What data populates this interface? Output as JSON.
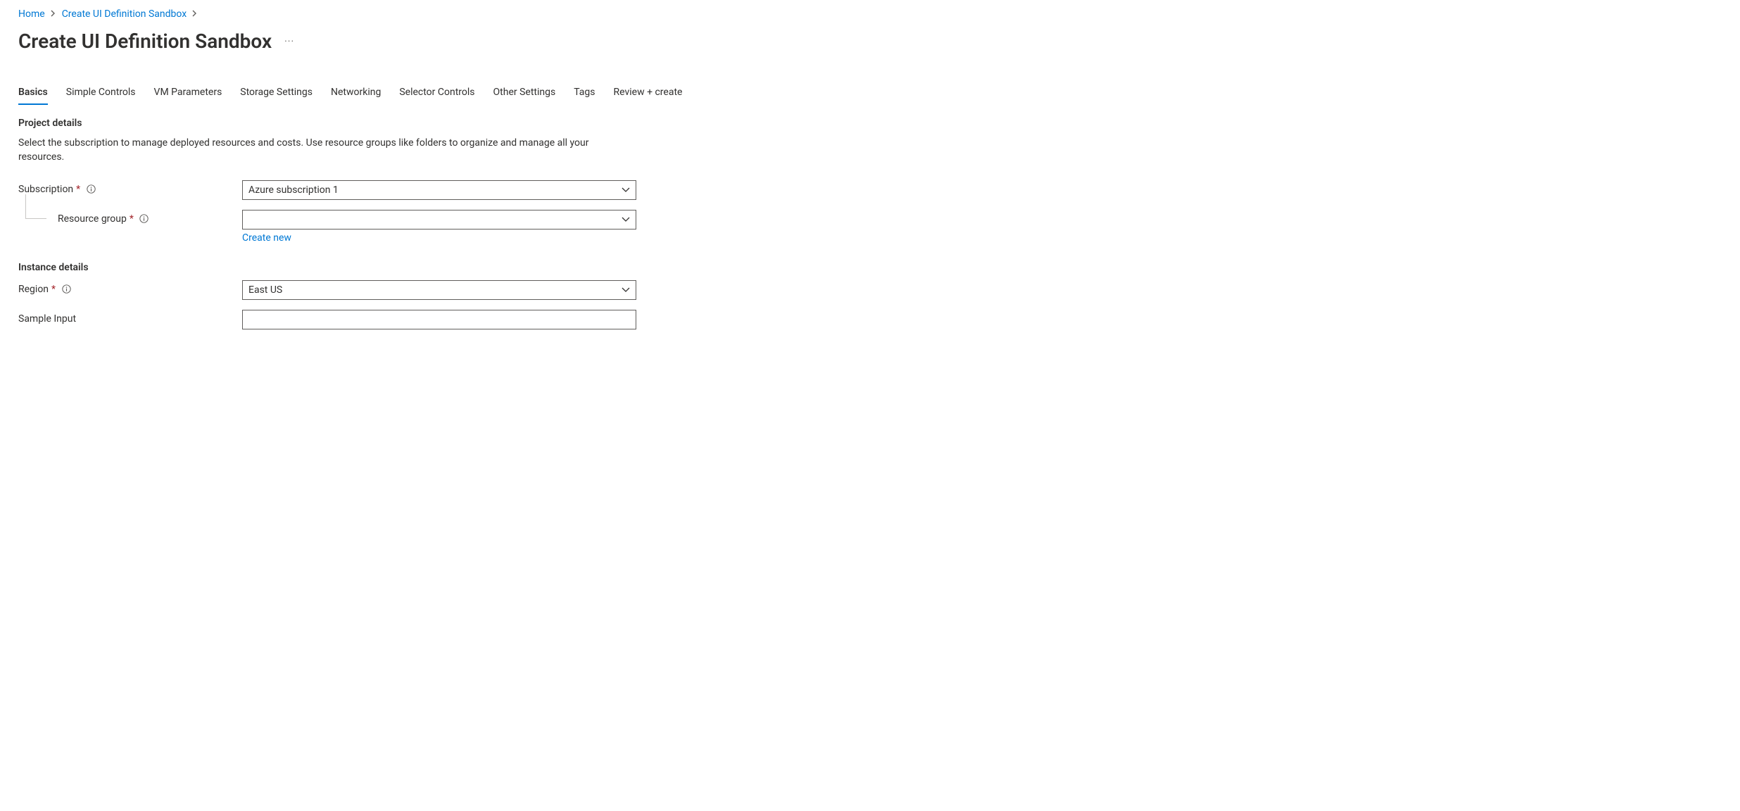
{
  "breadcrumb": {
    "home": "Home",
    "item1": "Create UI Definition Sandbox"
  },
  "page_title": "Create UI Definition Sandbox",
  "tabs": [
    "Basics",
    "Simple Controls",
    "VM Parameters",
    "Storage Settings",
    "Networking",
    "Selector Controls",
    "Other Settings",
    "Tags",
    "Review + create"
  ],
  "active_tab_index": 0,
  "project_details": {
    "heading": "Project details",
    "desc": "Select the subscription to manage deployed resources and costs. Use resource groups like folders to organize and manage all your resources.",
    "subscription": {
      "label": "Subscription",
      "value": "Azure subscription 1"
    },
    "resource_group": {
      "label": "Resource group",
      "value": "",
      "create_new": "Create new"
    }
  },
  "instance_details": {
    "heading": "Instance details",
    "region": {
      "label": "Region",
      "value": "East US"
    },
    "sample_input": {
      "label": "Sample Input",
      "value": ""
    }
  }
}
